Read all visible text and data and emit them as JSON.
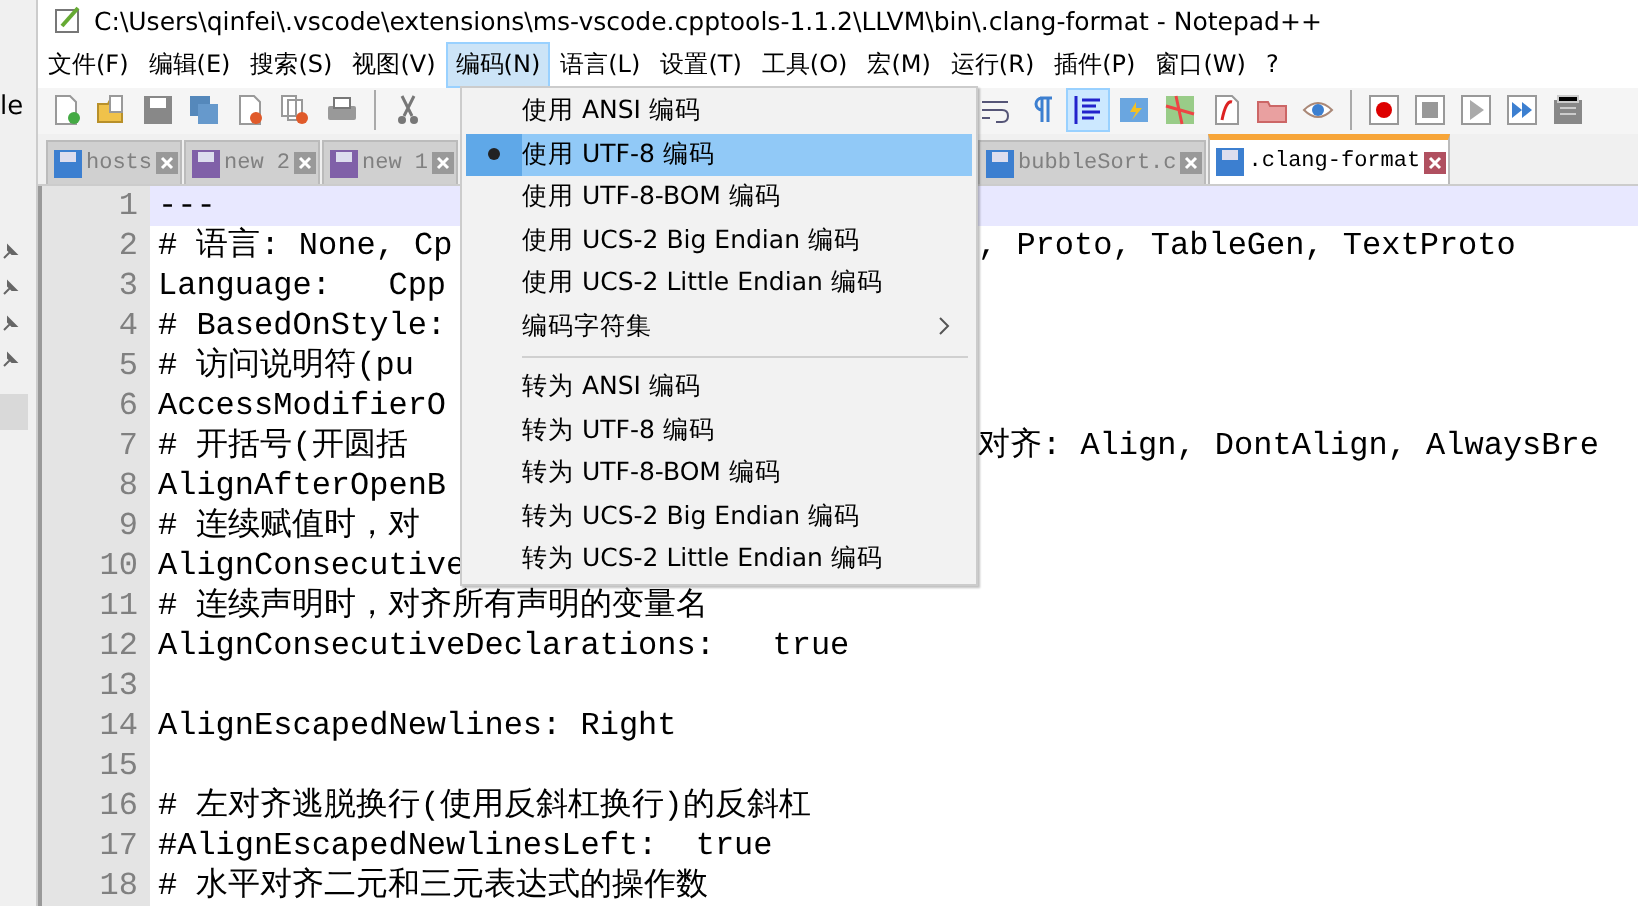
{
  "side_panel": {
    "text": "le"
  },
  "window": {
    "title": "C:\\Users\\qinfei\\.vscode\\extensions\\ms-vscode.cpptools-1.1.2\\LLVM\\bin\\.clang-format - Notepad++"
  },
  "menu_bar": [
    {
      "label": "文件(F)",
      "selected": false
    },
    {
      "label": "编辑(E)",
      "selected": false
    },
    {
      "label": "搜索(S)",
      "selected": false
    },
    {
      "label": "视图(V)",
      "selected": false
    },
    {
      "label": "编码(N)",
      "selected": true
    },
    {
      "label": "语言(L)",
      "selected": false
    },
    {
      "label": "设置(T)",
      "selected": false
    },
    {
      "label": "工具(O)",
      "selected": false
    },
    {
      "label": "宏(M)",
      "selected": false
    },
    {
      "label": "运行(R)",
      "selected": false
    },
    {
      "label": "插件(P)",
      "selected": false
    },
    {
      "label": "窗口(W)",
      "selected": false
    },
    {
      "label": "?",
      "selected": false
    }
  ],
  "toolbar": {
    "indent_guide_pressed": true
  },
  "tabs": [
    {
      "label": "hosts",
      "selected": false,
      "color": "#3c7fd0"
    },
    {
      "label": "new 2",
      "selected": false,
      "color": "#8060a8"
    },
    {
      "label": "new 1",
      "selected": false,
      "color": "#8060a8"
    },
    {
      "label": "bubbleSort.c",
      "selected": false,
      "color": "#3c7fd0"
    },
    {
      "label": ".clang-format",
      "selected": true,
      "color": "#3c7fd0"
    }
  ],
  "editor": {
    "lines": [
      {
        "number": "1",
        "text": "---",
        "current": true
      },
      {
        "number": "2",
        "text": "# 语言: None, Cp",
        "tail": ", Proto, TableGen, TextProto",
        "current": false
      },
      {
        "number": "3",
        "text": "Language:   Cpp",
        "current": false
      },
      {
        "number": "4",
        "text": "# BasedOnStyle:",
        "current": false
      },
      {
        "number": "5",
        "text": "# 访问说明符(pu",
        "current": false
      },
      {
        "number": "6",
        "text": "AccessModifierO",
        "current": false
      },
      {
        "number": "7",
        "text": "# 开括号(开圆括",
        "tail": "对齐: Align, DontAlign, AlwaysBre",
        "current": false
      },
      {
        "number": "8",
        "text": "AlignAfterOpenB",
        "current": false
      },
      {
        "number": "9",
        "text": "# 连续赋值时，对",
        "current": false
      },
      {
        "number": "10",
        "text": "AlignConsecutive",
        "current": false
      },
      {
        "number": "11",
        "text": "# 连续声明时，对齐所有声明的变量名",
        "current": false
      },
      {
        "number": "12",
        "text": "AlignConsecutiveDeclarations:   true",
        "current": false
      },
      {
        "number": "13",
        "current": false
      },
      {
        "number": "14",
        "text": "AlignEscapedNewlines: Right",
        "current": false
      },
      {
        "number": "15",
        "current": false
      },
      {
        "number": "16",
        "text": "# 左对齐逃脱换行(使用反斜杠换行)的反斜杠",
        "current": false
      },
      {
        "number": "17",
        "text": "#AlignEscapedNewlinesLeft:  true",
        "current": false
      },
      {
        "number": "18",
        "text": "# 水平对齐二元和三元表达式的操作数",
        "current": false
      }
    ]
  },
  "dropdown": {
    "items": [
      {
        "kind": "item",
        "label": "使用 ANSI 编码",
        "checked": false,
        "selected": false
      },
      {
        "kind": "item",
        "label": "使用 UTF-8 编码",
        "checked": true,
        "selected": true
      },
      {
        "kind": "item",
        "label": "使用 UTF-8-BOM 编码",
        "checked": false,
        "selected": false
      },
      {
        "kind": "item",
        "label": "使用 UCS-2 Big Endian 编码",
        "checked": false,
        "selected": false
      },
      {
        "kind": "item",
        "label": "使用 UCS-2 Little Endian 编码",
        "checked": false,
        "selected": false
      },
      {
        "kind": "submenu",
        "label": "编码字符集",
        "checked": false,
        "selected": false
      },
      {
        "kind": "separator"
      },
      {
        "kind": "item",
        "label": "转为 ANSI 编码",
        "checked": false,
        "selected": false
      },
      {
        "kind": "item",
        "label": "转为 UTF-8 编码",
        "checked": false,
        "selected": false
      },
      {
        "kind": "item",
        "label": "转为 UTF-8-BOM 编码",
        "checked": false,
        "selected": false
      },
      {
        "kind": "item",
        "label": "转为 UCS-2 Big Endian 编码",
        "checked": false,
        "selected": false
      },
      {
        "kind": "item",
        "label": "转为 UCS-2 Little Endian 编码",
        "checked": false,
        "selected": false
      }
    ]
  }
}
